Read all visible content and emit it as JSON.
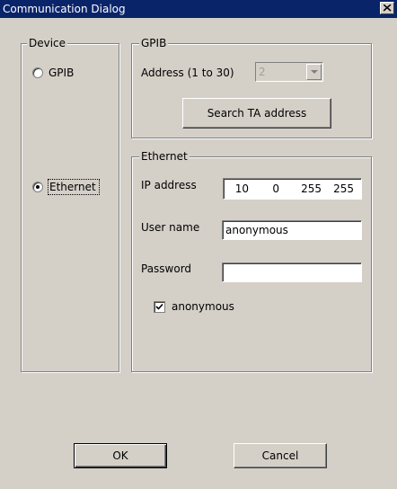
{
  "window": {
    "title": "Communication Dialog",
    "close_glyph": "×"
  },
  "device": {
    "legend": "Device",
    "gpib_label": "GPIB",
    "ethernet_label": "Ethernet",
    "selected": "Ethernet"
  },
  "gpib": {
    "legend": "GPIB",
    "address_label": "Address (1 to 30)",
    "address_value": "2",
    "search_button": "Search TA address",
    "enabled": false
  },
  "ethernet": {
    "legend": "Ethernet",
    "ip_label": "IP address",
    "ip": [
      "10",
      "0",
      "255",
      "255"
    ],
    "user_label": "User name",
    "user_value": "anonymous",
    "password_label": "Password",
    "password_value": "",
    "anonymous_label": "anonymous",
    "anonymous_checked": true
  },
  "buttons": {
    "ok": "OK",
    "cancel": "Cancel"
  },
  "icons": {
    "close": "close-icon",
    "dropdown": "chevron-down-icon",
    "check": "checkmark-icon"
  },
  "colors": {
    "titlebar": "#0a246a",
    "face": "#d4d0c8"
  }
}
